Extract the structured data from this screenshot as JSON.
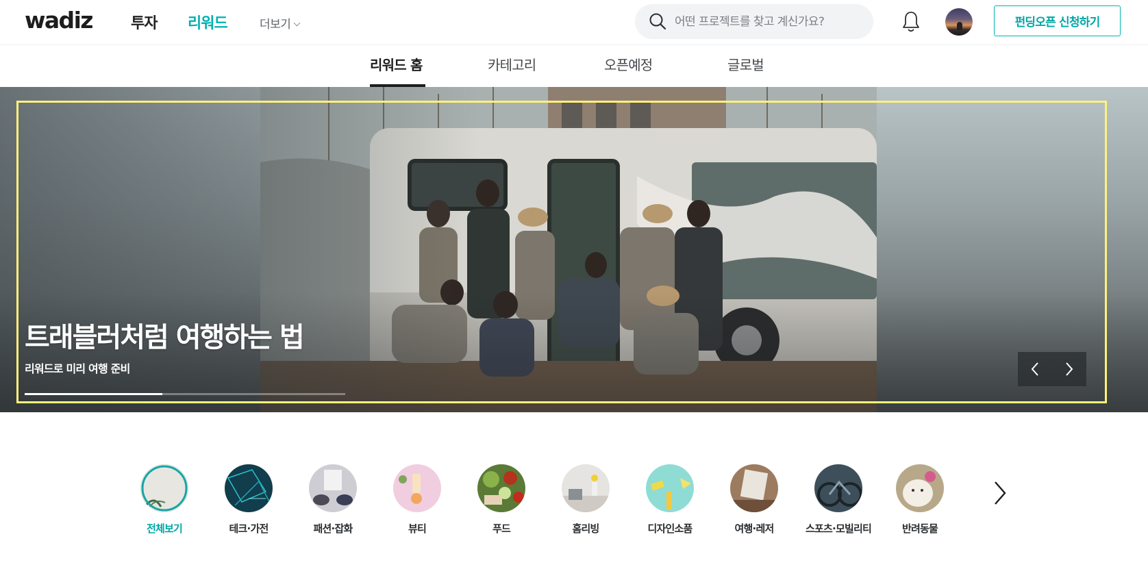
{
  "header": {
    "logo": "wadiz",
    "nav": {
      "invest": "투자",
      "reward": "리워드",
      "more": "더보기"
    },
    "search": {
      "placeholder": "어떤 프로젝트를 찾고 계신가요?",
      "value": ""
    },
    "funding_button": "펀딩오픈 신청하기",
    "accent_color": "#00b2b2"
  },
  "subnav": {
    "tabs": [
      {
        "label": "리워드 홈",
        "active": true
      },
      {
        "label": "카테고리",
        "active": false
      },
      {
        "label": "오픈예정",
        "active": false
      },
      {
        "label": "글로벌",
        "active": false
      }
    ]
  },
  "hero": {
    "title": "트래블러처럼 여행하는 법",
    "subtitle": "리워드로 미리 여행 준비",
    "progress_fraction": 0.43,
    "prev_icon": "chevron-left-icon",
    "next_icon": "chevron-right-icon"
  },
  "categories": {
    "items": [
      {
        "label": "전체보기",
        "icon": "all-thumbnail",
        "active": true
      },
      {
        "label": "테크·가전",
        "icon": "tech-thumbnail",
        "active": false
      },
      {
        "label": "패션·잡화",
        "icon": "fashion-thumbnail",
        "active": false
      },
      {
        "label": "뷰티",
        "icon": "beauty-thumbnail",
        "active": false
      },
      {
        "label": "푸드",
        "icon": "food-thumbnail",
        "active": false
      },
      {
        "label": "홈리빙",
        "icon": "home-living-thumbnail",
        "active": false
      },
      {
        "label": "디자인소품",
        "icon": "design-goods-thumbnail",
        "active": false
      },
      {
        "label": "여행·레저",
        "icon": "travel-leisure-thumbnail",
        "active": false
      },
      {
        "label": "스포츠·모빌리티",
        "icon": "sports-mobility-thumbnail",
        "active": false
      },
      {
        "label": "반려동물",
        "icon": "pets-thumbnail",
        "active": false
      }
    ],
    "next_icon": "chevron-right-icon"
  }
}
